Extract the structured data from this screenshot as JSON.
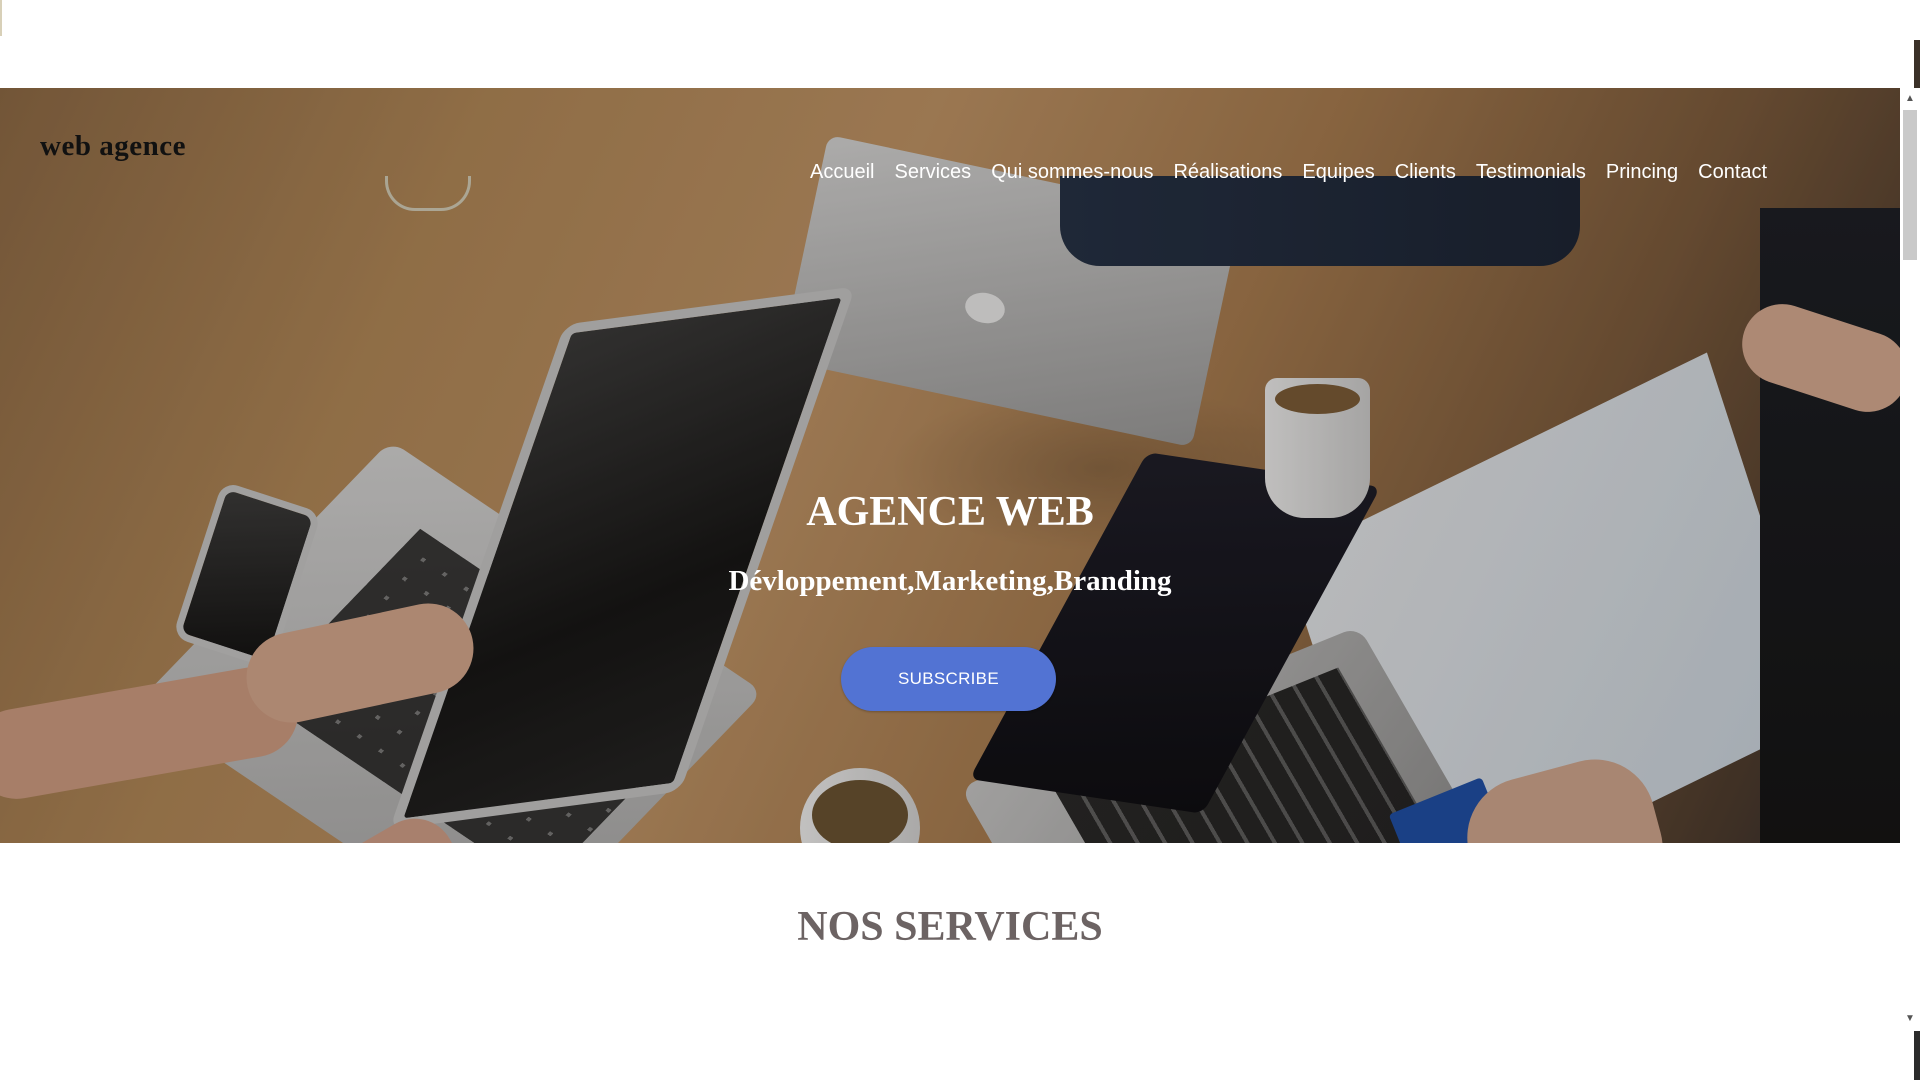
{
  "header": {
    "logo_text": "web agence",
    "nav": [
      {
        "label": "Accueil"
      },
      {
        "label": "Services"
      },
      {
        "label": "Qui sommes-nous"
      },
      {
        "label": "Réalisations"
      },
      {
        "label": "Equipes"
      },
      {
        "label": "Clients"
      },
      {
        "label": "Testimonials"
      },
      {
        "label": "Princing"
      },
      {
        "label": "Contact"
      }
    ]
  },
  "hero": {
    "title": "AGENCE WEB",
    "subtitle": "Dévloppement,Marketing,Branding",
    "cta_label": "SUBSCRIBE"
  },
  "services": {
    "title": "NOS SERVICES"
  },
  "scrollbar": {
    "up_icon": "▲",
    "down_icon": "▼"
  },
  "colors": {
    "cta_background": "#5273d3",
    "services_title": "#6c6363",
    "nav_text": "#ffffff"
  }
}
